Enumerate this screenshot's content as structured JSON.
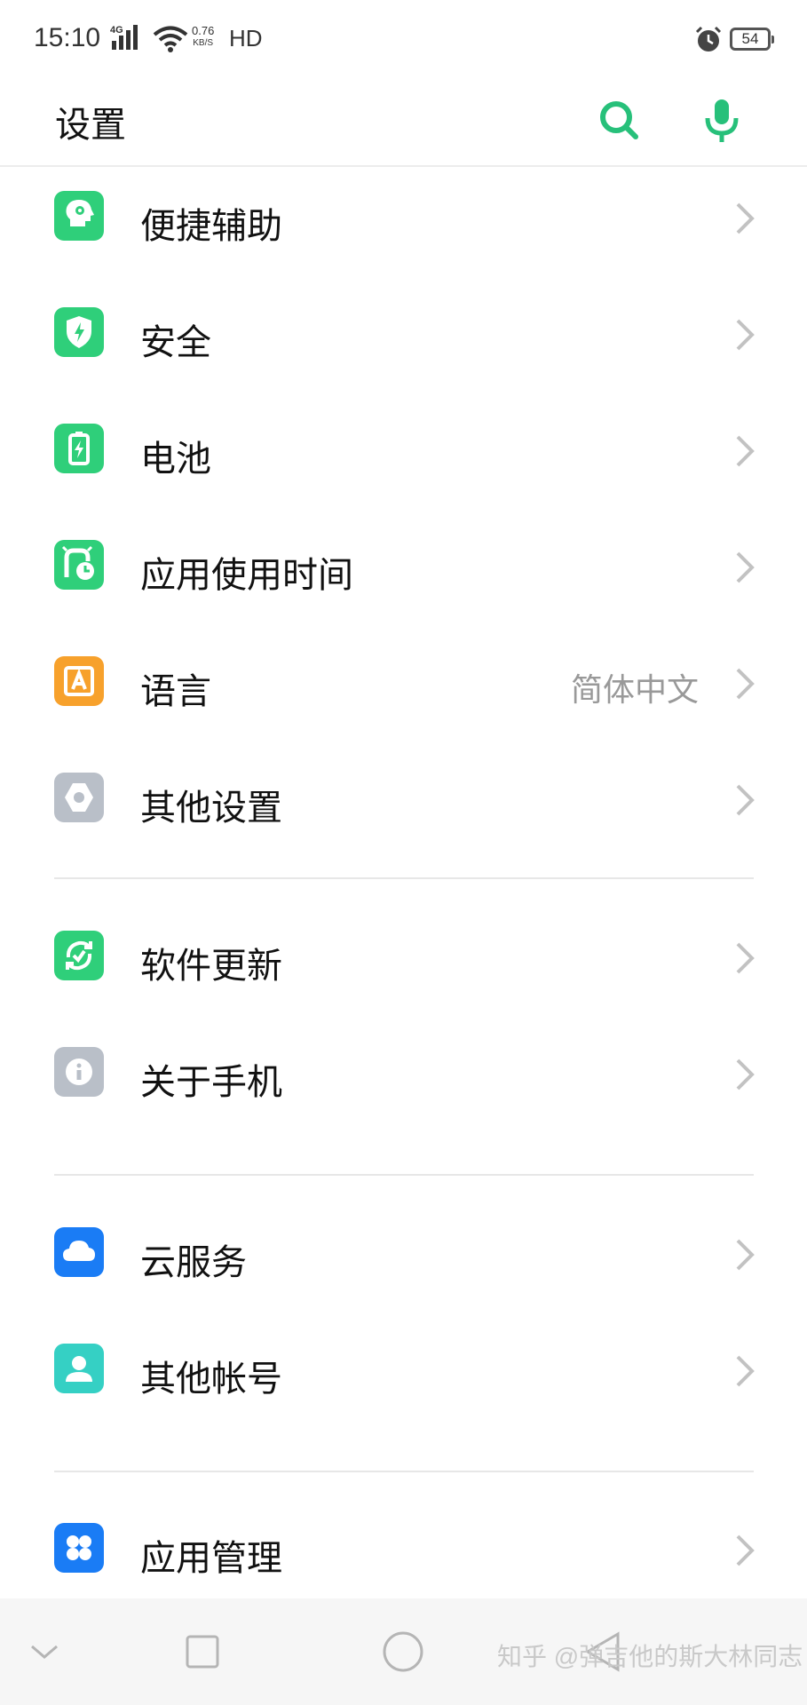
{
  "status_bar": {
    "time": "15:10",
    "network_type": "4G",
    "speed_value": "0.76",
    "speed_unit": "KB/S",
    "hd_label": "HD",
    "battery": "54"
  },
  "header": {
    "title": "设置",
    "accent_color": "#27c07a"
  },
  "settings": {
    "items": [
      {
        "label": "便捷辅助",
        "icon": "accessibility-icon",
        "color": "#2fcf7a"
      },
      {
        "label": "安全",
        "icon": "shield-icon",
        "color": "#2fcf7a"
      },
      {
        "label": "电池",
        "icon": "battery-icon",
        "color": "#2fcf7a"
      },
      {
        "label": "应用使用时间",
        "icon": "app-usage-time-icon",
        "color": "#2fcf7a"
      },
      {
        "label": "语言",
        "value": "简体中文",
        "icon": "language-icon",
        "color": "#f7a12c"
      },
      {
        "label": "其他设置",
        "icon": "other-settings-icon",
        "color": "#b9bfc8"
      },
      {
        "label": "软件更新",
        "icon": "software-update-icon",
        "color": "#2fcf7a"
      },
      {
        "label": "关于手机",
        "icon": "info-icon",
        "color": "#b9bfc8"
      },
      {
        "label": "云服务",
        "icon": "cloud-icon",
        "color": "#1a7cf5"
      },
      {
        "label": "其他帐号",
        "icon": "account-icon",
        "color": "#35d0c4"
      },
      {
        "label": "应用管理",
        "icon": "app-management-icon",
        "color": "#1a7cf5"
      }
    ]
  },
  "watermark": "知乎 @弹吉他的斯大林同志"
}
